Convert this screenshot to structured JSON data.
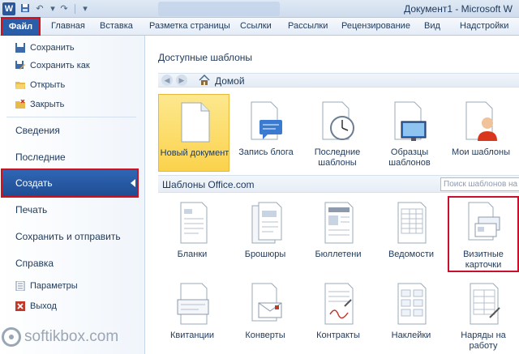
{
  "titlebar": {
    "app_icon": "W",
    "title": "Документ1  -  Microsoft W",
    "quick_access": [
      "save-icon",
      "undo-icon",
      "redo-icon",
      "customize-icon"
    ]
  },
  "ribbon": {
    "file_tab": "Файл",
    "tabs": [
      "Главная",
      "Вставка",
      "Разметка страницы",
      "Ссылки",
      "Рассылки",
      "Рецензирование",
      "Вид",
      "Надстройки"
    ]
  },
  "backstage": {
    "small_items_top": [
      {
        "label": "Сохранить",
        "icon": "save-icon"
      },
      {
        "label": "Сохранить как",
        "icon": "save-as-icon"
      },
      {
        "label": "Открыть",
        "icon": "folder-open-icon"
      },
      {
        "label": "Закрыть",
        "icon": "folder-close-icon"
      }
    ],
    "big_items": [
      "Сведения",
      "Последние",
      "Создать",
      "Печать",
      "Сохранить и отправить",
      "Справка"
    ],
    "small_items_bottom": [
      {
        "label": "Параметры",
        "icon": "options-icon"
      },
      {
        "label": "Выход",
        "icon": "exit-icon"
      }
    ],
    "selected": "Создать"
  },
  "templates": {
    "section_title": "Доступные шаблоны",
    "nav_home": "Домой",
    "items": [
      {
        "label": "Новый документ",
        "icon": "blank-document-icon"
      },
      {
        "label": "Запись блога",
        "icon": "blog-post-icon"
      },
      {
        "label": "Последние\nшаблоны",
        "icon": "recent-templates-icon"
      },
      {
        "label": "Образцы\nшаблонов",
        "icon": "sample-templates-icon"
      },
      {
        "label": "Мои шаблоны",
        "icon": "my-templates-icon"
      }
    ],
    "office_title": "Шаблоны Office.com",
    "search_placeholder": "Поиск шаблонов на са",
    "office_items": [
      {
        "label": "Бланки",
        "icon": "forms-icon"
      },
      {
        "label": "Брошюры",
        "icon": "brochures-icon"
      },
      {
        "label": "Бюллетени",
        "icon": "newsletters-icon"
      },
      {
        "label": "Ведомости",
        "icon": "statements-icon"
      },
      {
        "label": "Визитные\nкарточки",
        "icon": "business-cards-icon"
      },
      {
        "label": "Квитанции",
        "icon": "receipts-icon"
      },
      {
        "label": "Конверты",
        "icon": "envelopes-icon"
      },
      {
        "label": "Контракты",
        "icon": "contracts-icon"
      },
      {
        "label": "Наклейки",
        "icon": "labels-icon"
      },
      {
        "label": "Наряды на\nработу",
        "icon": "work-orders-icon"
      }
    ]
  },
  "watermark": "softikbox.com",
  "colors": {
    "accent": "#2a5ea8",
    "highlight": "#d0101a",
    "selected_tile": "#fbd24c"
  }
}
